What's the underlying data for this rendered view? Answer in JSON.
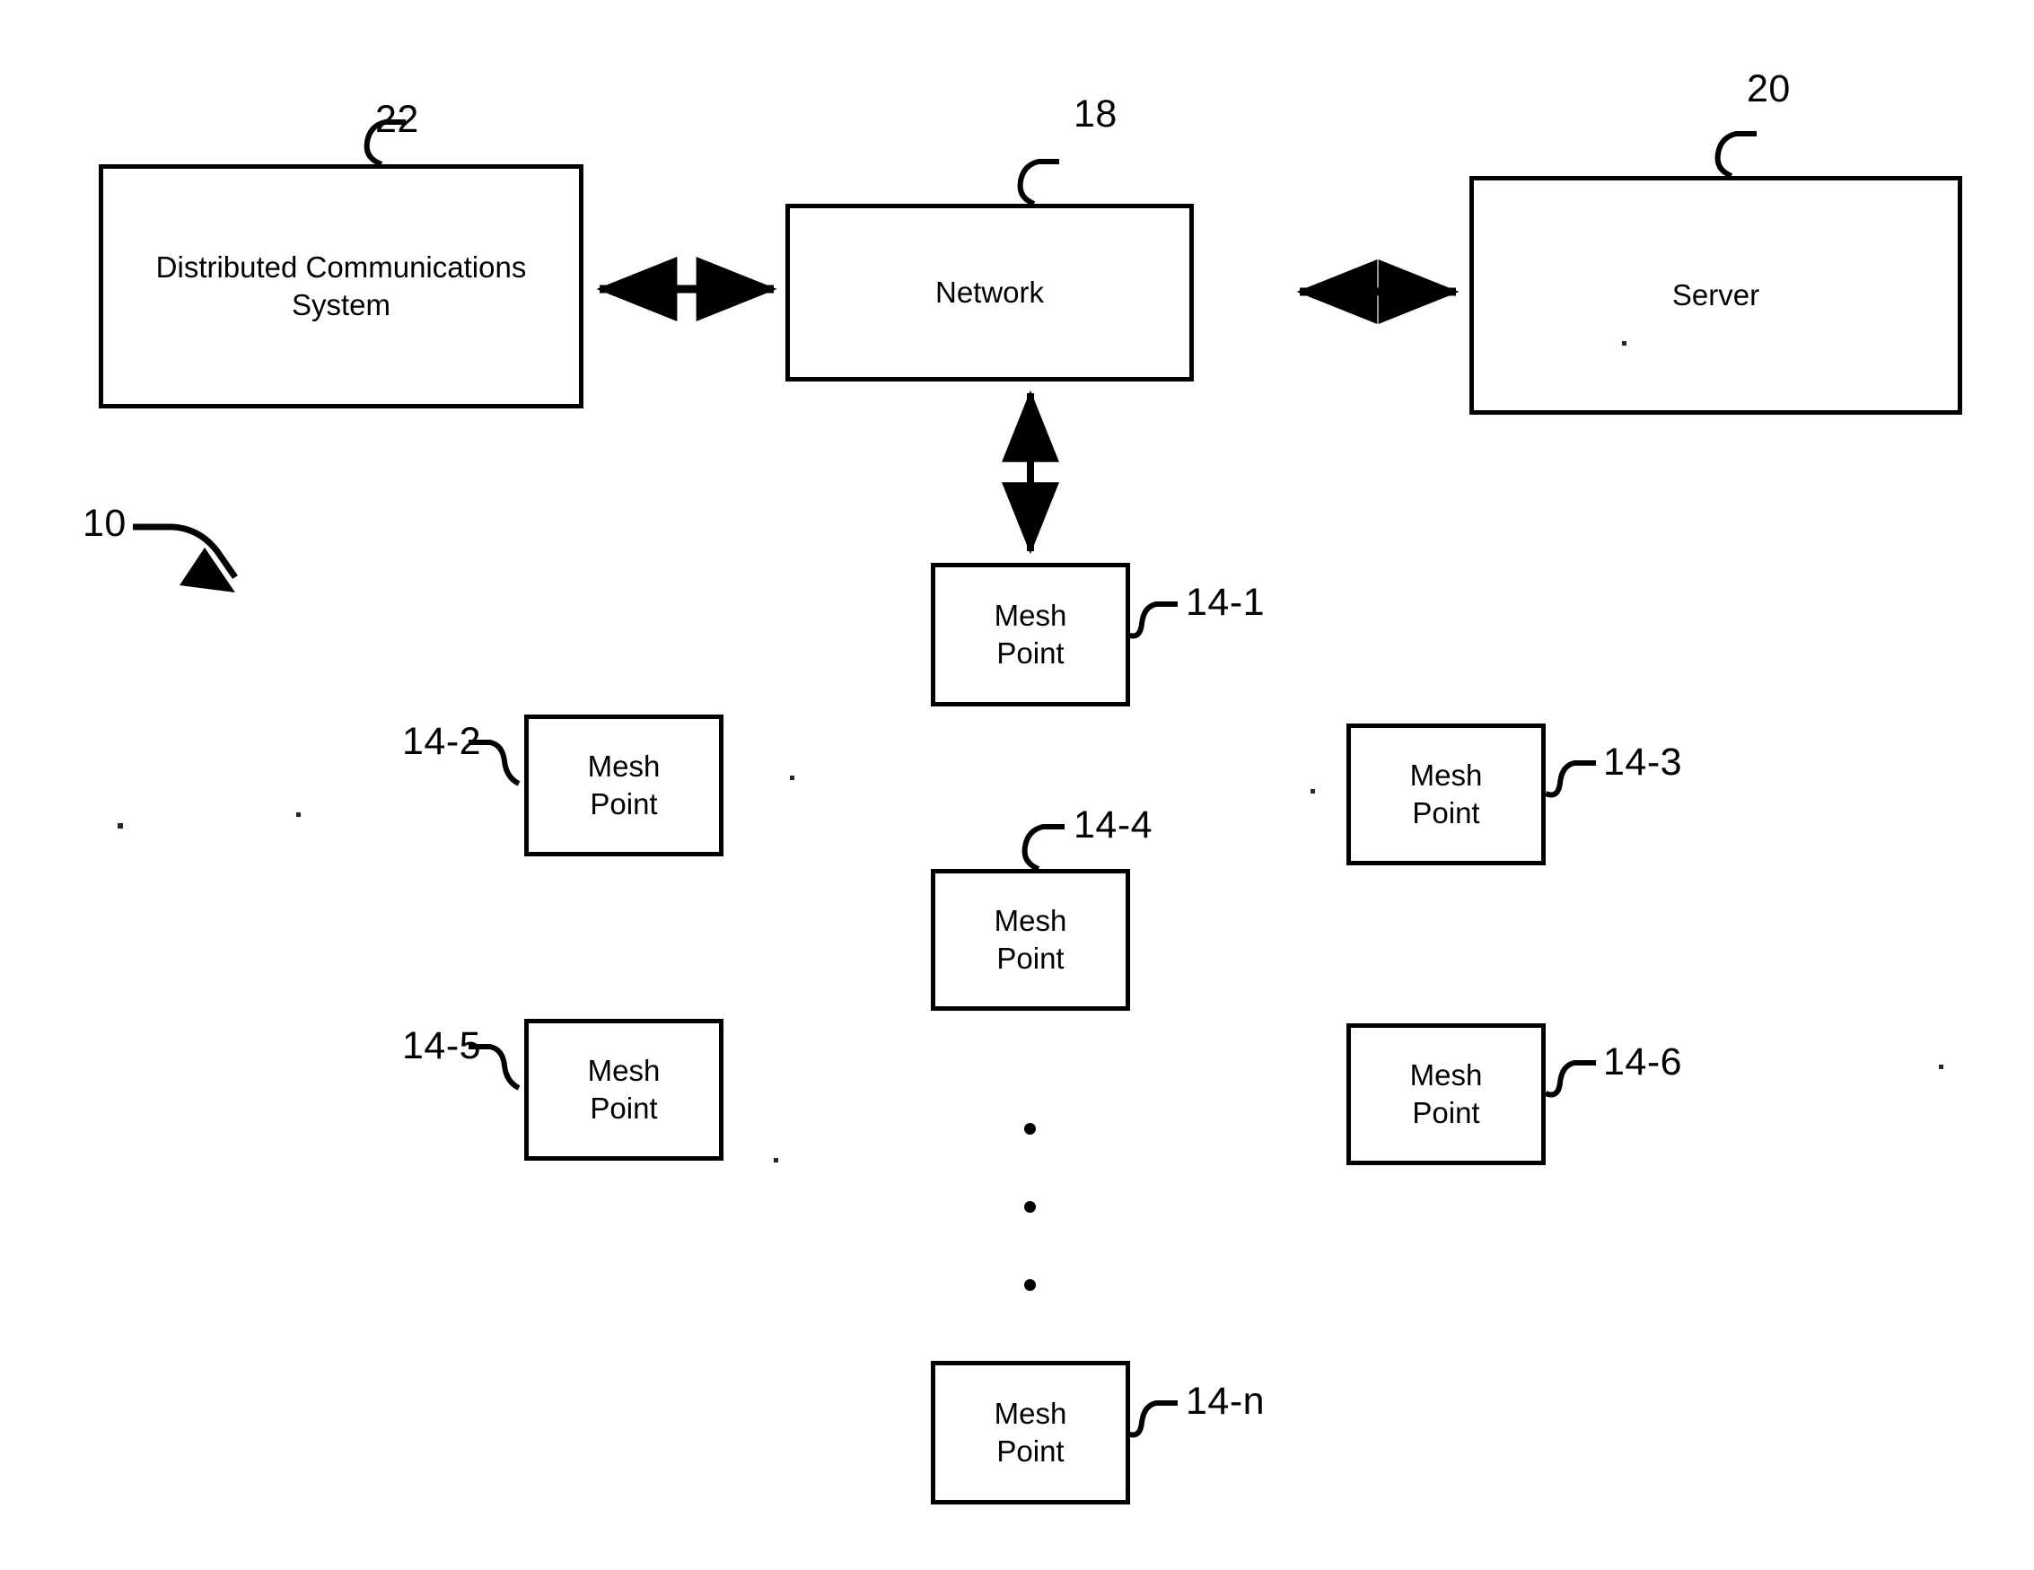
{
  "figure": {
    "system_ref": "10",
    "nodes": [
      {
        "id": "dcs",
        "label": "Distributed Communications\nSystem",
        "ref": "22"
      },
      {
        "id": "network",
        "label": "Network",
        "ref": "18"
      },
      {
        "id": "server",
        "label": "Server",
        "ref": "20"
      },
      {
        "id": "mesh-1",
        "label": "Mesh\nPoint",
        "ref": "14-1"
      },
      {
        "id": "mesh-2",
        "label": "Mesh\nPoint",
        "ref": "14-2"
      },
      {
        "id": "mesh-3",
        "label": "Mesh\nPoint",
        "ref": "14-3"
      },
      {
        "id": "mesh-4",
        "label": "Mesh\nPoint",
        "ref": "14-4"
      },
      {
        "id": "mesh-5",
        "label": "Mesh\nPoint",
        "ref": "14-5"
      },
      {
        "id": "mesh-6",
        "label": "Mesh\nPoint",
        "ref": "14-6"
      },
      {
        "id": "mesh-n",
        "label": "Mesh\nPoint",
        "ref": "14-n"
      }
    ],
    "connections": [
      {
        "id": "dcs-network",
        "from": "dcs",
        "to": "network",
        "style": "double-arrow-horizontal"
      },
      {
        "id": "network-server",
        "from": "network",
        "to": "server",
        "style": "double-arrow-horizontal"
      },
      {
        "id": "network-mesh-1",
        "from": "network",
        "to": "mesh-1",
        "style": "double-arrow-vertical"
      }
    ],
    "ellipsis": {
      "id": "vertical-ellipsis",
      "count": 3,
      "symbol": "•"
    },
    "colors": {
      "stroke": "#000000",
      "background": "#ffffff",
      "text": "#000000"
    }
  }
}
